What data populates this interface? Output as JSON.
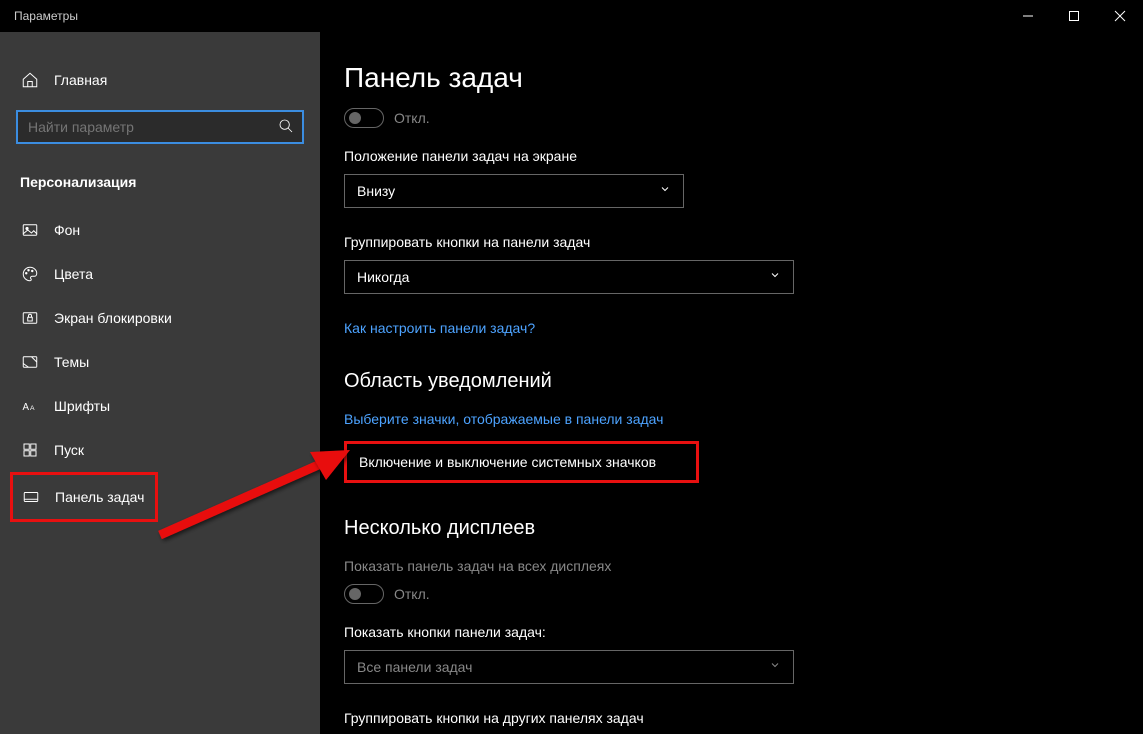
{
  "titlebar": {
    "title": "Параметры"
  },
  "sidebar": {
    "home_label": "Главная",
    "search_placeholder": "Найти параметр",
    "section_title": "Персонализация",
    "items": [
      {
        "icon": "picture",
        "label": "Фон"
      },
      {
        "icon": "palette",
        "label": "Цвета"
      },
      {
        "icon": "lockscreen",
        "label": "Экран блокировки"
      },
      {
        "icon": "themes",
        "label": "Темы"
      },
      {
        "icon": "fonts",
        "label": "Шрифты"
      },
      {
        "icon": "start",
        "label": "Пуск"
      },
      {
        "icon": "taskbar",
        "label": "Панель задач"
      }
    ]
  },
  "content": {
    "heading": "Панель задач",
    "toggle1_state": "Откл.",
    "setting_position_label": "Положение панели задач на экране",
    "setting_position_value": "Внизу",
    "setting_group_label": "Группировать кнопки на панели задач",
    "setting_group_value": "Никогда",
    "link_configure": "Как настроить панели задач?",
    "section_notification": "Область уведомлений",
    "link_select_icons": "Выберите значки, отображаемые в панели задач",
    "link_system_icons": "Включение и выключение системных значков",
    "section_displays": "Несколько дисплеев",
    "setting_show_label": "Показать панель задач на всех дисплеях",
    "toggle2_state": "Откл.",
    "setting_show_buttons_label": "Показать кнопки панели задач:",
    "setting_show_buttons_value": "Все панели задач",
    "setting_group_other_label": "Группировать кнопки на других панелях задач"
  }
}
